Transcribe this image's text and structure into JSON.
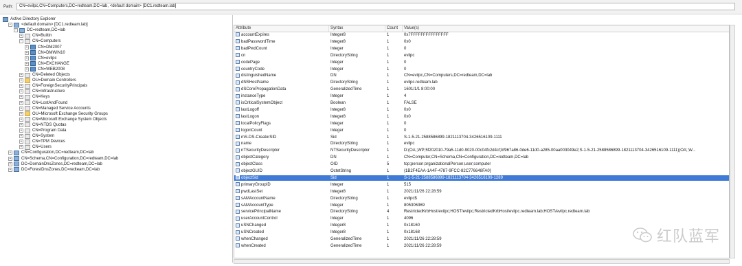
{
  "path_label": "Path:",
  "path_value": "CN=evilpc,CN=Computers,DC=redteam,DC=lab, <default domain> [DC1.redteam.lab]",
  "tree": [
    {
      "text": "Active Directory Explorer",
      "icon": "root",
      "indent": 0,
      "toggle": ""
    },
    {
      "text": "<default domain> [DC1.redteam.lab]",
      "icon": "dom",
      "indent": 1,
      "toggle": "−"
    },
    {
      "text": "DC=redteam,DC=lab",
      "icon": "dom",
      "indent": 2,
      "toggle": "−"
    },
    {
      "text": "CN=Builtin",
      "icon": "cont",
      "indent": 3,
      "toggle": "+"
    },
    {
      "text": "CN=Computers",
      "icon": "cont",
      "indent": 3,
      "toggle": "−"
    },
    {
      "text": "CN=DM2007",
      "icon": "comp",
      "indent": 4,
      "toggle": "+"
    },
    {
      "text": "CN=DMWIN10",
      "icon": "comp",
      "indent": 4,
      "toggle": "+"
    },
    {
      "text": "CN=evilpc",
      "icon": "comp",
      "indent": 4,
      "toggle": "+"
    },
    {
      "text": "CN=EXCHANGE",
      "icon": "comp",
      "indent": 4,
      "toggle": "+"
    },
    {
      "text": "CN=WEB2008",
      "icon": "comp",
      "indent": 4,
      "toggle": "+"
    },
    {
      "text": "CN=Deleted Objects",
      "icon": "cont",
      "indent": 3,
      "toggle": "+"
    },
    {
      "text": "OU=Domain Controllers",
      "icon": "ou",
      "indent": 3,
      "toggle": "+"
    },
    {
      "text": "CN=ForeignSecurityPrincipals",
      "icon": "cont",
      "indent": 3,
      "toggle": "+"
    },
    {
      "text": "CN=Infrastructure",
      "icon": "cont",
      "indent": 3,
      "toggle": "+"
    },
    {
      "text": "CN=Keys",
      "icon": "cont",
      "indent": 3,
      "toggle": "+"
    },
    {
      "text": "CN=LostAndFound",
      "icon": "cont",
      "indent": 3,
      "toggle": "+"
    },
    {
      "text": "CN=Managed Service Accounts",
      "icon": "cont",
      "indent": 3,
      "toggle": "+"
    },
    {
      "text": "OU=Microsoft Exchange Security Groups",
      "icon": "ou",
      "indent": 3,
      "toggle": "+"
    },
    {
      "text": "CN=Microsoft Exchange System Objects",
      "icon": "cont",
      "indent": 3,
      "toggle": "+"
    },
    {
      "text": "CN=NTDS Quotas",
      "icon": "cont",
      "indent": 3,
      "toggle": "+"
    },
    {
      "text": "CN=Program Data",
      "icon": "cont",
      "indent": 3,
      "toggle": "+"
    },
    {
      "text": "CN=System",
      "icon": "cont",
      "indent": 3,
      "toggle": "+"
    },
    {
      "text": "CN=TPM Devices",
      "icon": "cont",
      "indent": 3,
      "toggle": "+"
    },
    {
      "text": "CN=Users",
      "icon": "cont",
      "indent": 3,
      "toggle": "+"
    },
    {
      "text": "CN=Configuration,DC=redteam,DC=lab",
      "icon": "dom",
      "indent": 1,
      "toggle": "+"
    },
    {
      "text": "CN=Schema,CN=Configuration,DC=redteam,DC=lab",
      "icon": "dom",
      "indent": 1,
      "toggle": "+"
    },
    {
      "text": "DC=DomainDnsZones,DC=redteam,DC=lab",
      "icon": "dom",
      "indent": 1,
      "toggle": "+"
    },
    {
      "text": "DC=ForestDnsZones,DC=redteam,DC=lab",
      "icon": "dom",
      "indent": 1,
      "toggle": "+"
    }
  ],
  "grid": {
    "headers": [
      "Attribute",
      "Syntax",
      "Count",
      "Value(s)"
    ],
    "rows": [
      [
        "accountExpires",
        "Integer8",
        "1",
        "0x7FFFFFFFFFFFFFFF"
      ],
      [
        "badPasswordTime",
        "Integer8",
        "1",
        "0x0"
      ],
      [
        "badPwdCount",
        "Integer",
        "1",
        "0"
      ],
      [
        "cn",
        "DirectoryString",
        "1",
        "evilpc"
      ],
      [
        "codePage",
        "Integer",
        "1",
        "0"
      ],
      [
        "countryCode",
        "Integer",
        "1",
        "0"
      ],
      [
        "distinguishedName",
        "DN",
        "1",
        "CN=evilpc,CN=Computers,DC=redteam,DC=lab"
      ],
      [
        "dNSHostName",
        "DirectoryString",
        "1",
        "evilpc.redteam.lab"
      ],
      [
        "dSCorePropagationData",
        "GeneralizedTime",
        "1",
        "1601/1/1 8:00:00"
      ],
      [
        "instanceType",
        "Integer",
        "1",
        "4"
      ],
      [
        "isCriticalSystemObject",
        "Boolean",
        "1",
        "FALSE"
      ],
      [
        "lastLogoff",
        "Integer8",
        "1",
        "0x0"
      ],
      [
        "lastLogon",
        "Integer8",
        "1",
        "0x0"
      ],
      [
        "localPolicyFlags",
        "Integer",
        "1",
        "0"
      ],
      [
        "logonCount",
        "Integer",
        "1",
        "0"
      ],
      [
        "mS-DS-CreatorSID",
        "Sid",
        "1",
        "S-1-5-21-2588586899-1821113704-3426516109-1111"
      ],
      [
        "name",
        "DirectoryString",
        "1",
        "evilpc"
      ],
      [
        "nTSecurityDescriptor",
        "NTSecurityDescriptor",
        "1",
        "D:(OA;;WP;5f202010-79a5-11d0-9020-00c04fc2d4cf;bf967a86-0de6-11d0-a285-00aa003049e2;S-1-5-21-2588586899-1821113704-3426516109-1111)(OA;;W..."
      ],
      [
        "objectCategory",
        "DN",
        "1",
        "CN=Computer,CN=Schema,CN=Configuration,DC=redteam,DC=lab"
      ],
      [
        "objectClass",
        "OID",
        "5",
        "top;person;organizationalPerson;user;computer"
      ],
      [
        "objectGUID",
        "OctetString",
        "1",
        "{1B2F4EAA-1A4F-4787-9FCC-82C776648FA0}"
      ],
      [
        "objectSid",
        "Sid",
        "1",
        "S-1-5-21-2588586899-1821113704-3426516109-1289"
      ],
      [
        "primaryGroupID",
        "Integer",
        "1",
        "515"
      ],
      [
        "pwdLastSet",
        "Integer8",
        "1",
        "2021/11/26 22:28:59"
      ],
      [
        "sAMAccountName",
        "DirectoryString",
        "1",
        "evilpc$"
      ],
      [
        "sAMAccountType",
        "Integer",
        "1",
        "805306369"
      ],
      [
        "servicePrincipalName",
        "DirectoryString",
        "4",
        "RestrictedKrbHost/evilpc;HOST/evilpc;RestrictedKrbHost/evilpc.redteam.lab;HOST/evilpc.redteam.lab"
      ],
      [
        "userAccountControl",
        "Integer",
        "1",
        "4096"
      ],
      [
        "uSNChanged",
        "Integer8",
        "1",
        "0x18160"
      ],
      [
        "uSNCreated",
        "Integer8",
        "1",
        "0x18168"
      ],
      [
        "whenChanged",
        "GeneralizedTime",
        "1",
        "2021/11/26 22:28:59"
      ],
      [
        "whenCreated",
        "GeneralizedTime",
        "1",
        "2021/11/26 22:28:59"
      ]
    ],
    "selected_attribute": "objectSid"
  },
  "watermark": {
    "text": "红队蓝军",
    "icon": "wechat-icon"
  }
}
